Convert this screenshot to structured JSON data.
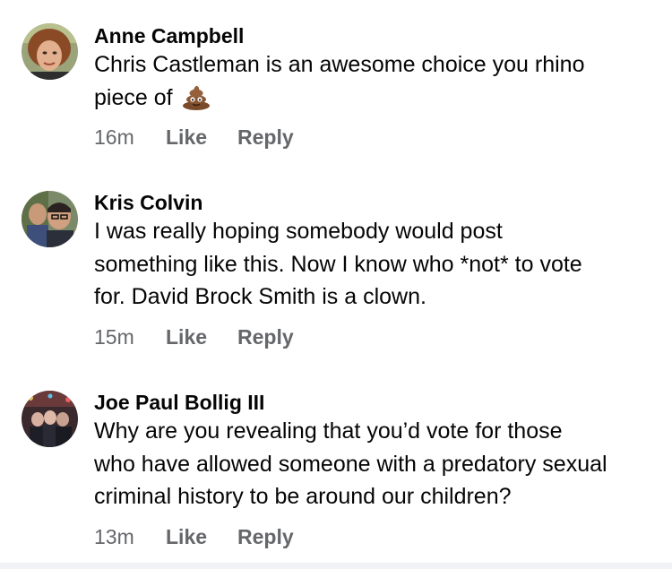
{
  "comments": [
    {
      "author": "Anne Campbell",
      "lines": [
        "Chris Castleman is an awesome choice you rhino",
        "piece of"
      ],
      "emoji": "pile-of-poo",
      "time": "16m",
      "like_label": "Like",
      "reply_label": "Reply"
    },
    {
      "author": "Kris Colvin",
      "lines": [
        "I was really hoping somebody would post",
        "something like this. Now I know who *not* to vote",
        "for. David Brock Smith is a clown."
      ],
      "time": "15m",
      "like_label": "Like",
      "reply_label": "Reply"
    },
    {
      "author": "Joe Paul Bollig III",
      "lines": [
        "Why are you revealing that you’d vote for those",
        "who have allowed someone with a predatory sexual",
        "criminal history to be around our children?"
      ],
      "time": "13m",
      "like_label": "Like",
      "reply_label": "Reply"
    }
  ],
  "colors": {
    "text": "#050505",
    "meta": "#65676b",
    "background": "#ffffff"
  }
}
